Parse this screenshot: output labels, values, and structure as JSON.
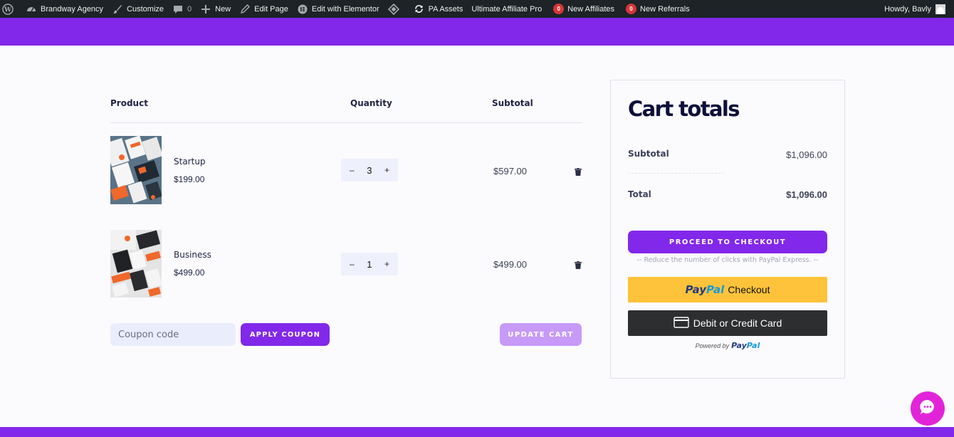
{
  "adminbar": {
    "site_name": "Brandway Agency",
    "customize": "Customize",
    "comments_count": "0",
    "new": "New",
    "edit_page": "Edit Page",
    "edit_elementor": "Edit with Elementor",
    "pa_assets": "PA Assets",
    "affiliate_pro": "Ultimate Affiliate Pro",
    "new_affiliates_count": "0",
    "new_affiliates": "New Affiliates",
    "new_referrals_count": "0",
    "new_referrals": "New Referrals",
    "howdy": "Howdy, Bavly"
  },
  "cart": {
    "headers": {
      "product": "Product",
      "quantity": "Quantity",
      "subtotal": "Subtotal"
    },
    "items": [
      {
        "name": "Startup",
        "price": "$199.00",
        "qty": "3",
        "minus": "–",
        "plus": "+",
        "subtotal": "$597.00"
      },
      {
        "name": "Business",
        "price": "$499.00",
        "qty": "1",
        "minus": "–",
        "plus": "+",
        "subtotal": "$499.00"
      }
    ],
    "coupon_placeholder": "Coupon code",
    "apply_coupon": "APPLY COUPON",
    "update_cart": "UPDATE CART"
  },
  "totals": {
    "title": "Cart totals",
    "subtotal_label": "Subtotal",
    "subtotal_value": "$1,096.00",
    "total_label": "Total",
    "total_value": "$1,096.00",
    "checkout": "PROCEED TO CHECKOUT",
    "paypal_note": "-- Reduce the number of clicks with PayPal Express. --",
    "paypal_pay": "Pay",
    "paypal_pal": "Pal",
    "paypal_checkout": "Checkout",
    "card": "Debit or Credit Card",
    "powered_by": "Powered by"
  },
  "colors": {
    "brand": "#8228ea",
    "brand_light": "#c69af6",
    "adminbar": "#1d2327",
    "paypal_yellow": "#fec33a",
    "card_dark": "#2c2e2f",
    "chat": "#e224d9"
  },
  "icons": [
    "wordpress-icon",
    "dashboard-icon",
    "brush-icon",
    "comment-icon",
    "plus-icon",
    "pencil-icon",
    "elementor-icon",
    "diamond-icon",
    "sync-icon",
    "trash-icon",
    "card-icon",
    "chat-icon"
  ]
}
